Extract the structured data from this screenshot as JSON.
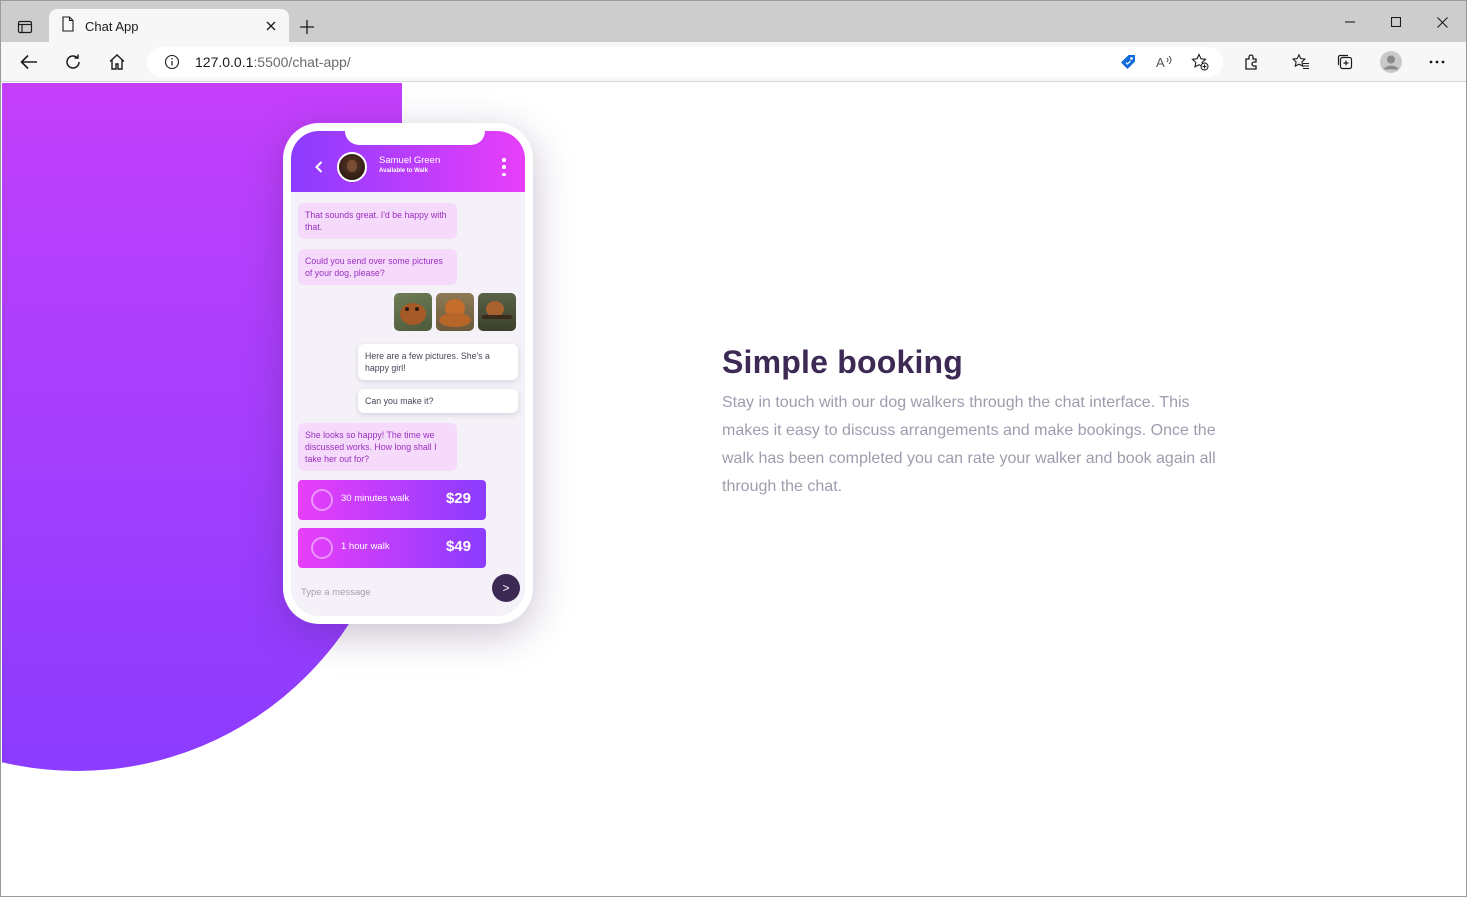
{
  "browser": {
    "tab_title": "Chat App",
    "url_host": "127.0.0.1",
    "url_rest": ":5500/chat-app/"
  },
  "chat": {
    "contact_name": "Samuel Green",
    "contact_status": "Available to Walk",
    "messages": [
      {
        "from": "walker",
        "text": "That sounds great. I'd be happy with that."
      },
      {
        "from": "walker",
        "text": "Could you send over some pictures of your dog, please?"
      },
      {
        "from": "owner",
        "text": "Here are a few pictures. She's a happy girl!"
      },
      {
        "from": "owner",
        "text": "Can you make it?"
      },
      {
        "from": "walker",
        "text": "She looks so happy! The time we discussed works. How long shall I take her out for?"
      }
    ],
    "offers": [
      {
        "label": "30 minutes walk",
        "price": "$29"
      },
      {
        "label": "1 hour walk",
        "price": "$49"
      }
    ],
    "input_placeholder": "Type a message",
    "send_label": ">"
  },
  "feature": {
    "title": "Simple booking",
    "description": "Stay in touch with our dog walkers through the chat interface. This makes it easy to discuss arrangements and make bookings. Once the walk has been completed you can rate your walker and book again all through the chat."
  },
  "colors": {
    "gradient_start": "#e83ef9",
    "gradient_end": "#8b3cff",
    "headline": "#3c2a55",
    "body_text": "#a19bae"
  }
}
